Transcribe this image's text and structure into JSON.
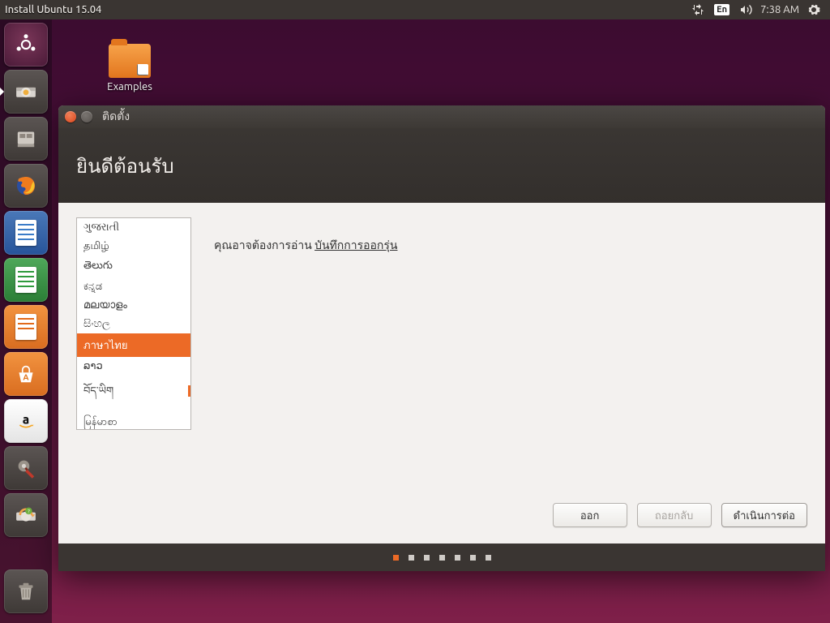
{
  "top_panel": {
    "title": "Install Ubuntu 15.04",
    "lang_indicator": "En",
    "time": "7:38 AM"
  },
  "desktop": {
    "examples_label": "Examples"
  },
  "installer": {
    "titlebar": "ติดตั้ง",
    "header": "ยินดีต้อนรับ",
    "notes_prefix": "คุณอาจต้องการอ่าน ",
    "notes_link": "บันทึกการออกรุ่น",
    "languages": [
      "ગુજરાતી",
      "தமிழ்",
      "తెలుగు",
      "ಕನ್ನಡ",
      "മലയാളം",
      "සිංහල",
      "ภาษาไทย",
      "ລາວ",
      "བོད་ཡིག",
      "မြန်မာစာ"
    ],
    "selected_index": 6,
    "buttons": {
      "quit": "ออก",
      "back": "ถอยกลับ",
      "continue": "ดำเนินการต่อ"
    },
    "step_count": 7,
    "active_step": 0
  }
}
